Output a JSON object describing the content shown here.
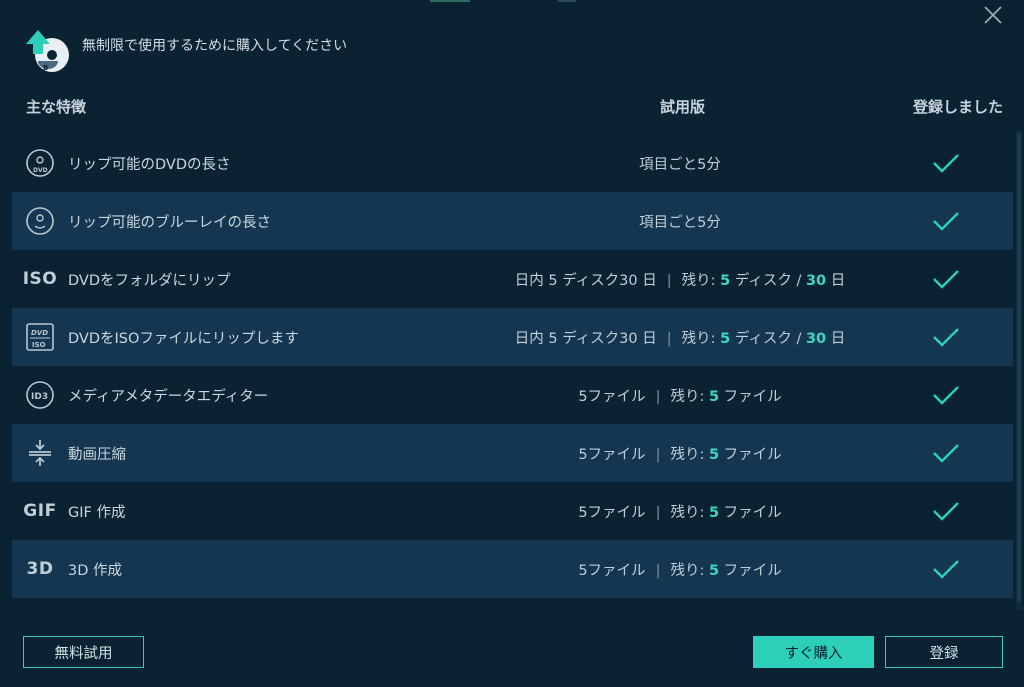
{
  "header": {
    "message": "無制限で使用するために購入してください"
  },
  "columns": {
    "feature": "主な特徴",
    "trial": "試用版",
    "registered": "登録しました"
  },
  "icon_text": {
    "iso": "ISO",
    "gif": "GIF",
    "3d": "3D"
  },
  "rows": [
    {
      "icon": "dvd-disc-icon",
      "label": "リップ可能のDVDの長さ",
      "trial_text": "項目ごと5分"
    },
    {
      "icon": "bluray-disc-icon",
      "label": "リップ可能のブルーレイの長さ",
      "trial_text": "項目ごと5分"
    },
    {
      "icon": "iso-icon",
      "label": "DVDをフォルダにリップ",
      "trial_prefix": "日内 5 ディスク30 日",
      "remain_label": "残り:",
      "remain_num": "5",
      "remain_unit": "ディスク /",
      "remain_num2": "30",
      "remain_unit2": "日"
    },
    {
      "icon": "dvd-iso-icon",
      "label": "DVDをISOファイルにリップします",
      "trial_prefix": "日内 5 ディスク30 日",
      "remain_label": "残り:",
      "remain_num": "5",
      "remain_unit": "ディスク /",
      "remain_num2": "30",
      "remain_unit2": "日"
    },
    {
      "icon": "id3-icon",
      "label": "メディアメタデータエディター",
      "trial_prefix": "5ファイル",
      "remain_label": "残り:",
      "remain_num": "5",
      "remain_unit": "ファイル"
    },
    {
      "icon": "compress-icon",
      "label": "動画圧縮",
      "trial_prefix": "5ファイル",
      "remain_label": "残り:",
      "remain_num": "5",
      "remain_unit": "ファイル"
    },
    {
      "icon": "gif-icon",
      "label": "GIF 作成",
      "trial_prefix": "5ファイル",
      "remain_label": "残り:",
      "remain_num": "5",
      "remain_unit": "ファイル"
    },
    {
      "icon": "3d-icon",
      "label": "3D 作成",
      "trial_prefix": "5ファイル",
      "remain_label": "残り:",
      "remain_num": "5",
      "remain_unit": "ファイル"
    }
  ],
  "separator": "|",
  "buttons": {
    "free_trial": "無料試用",
    "buy_now": "すぐ購入",
    "register": "登録"
  },
  "colors": {
    "background": "#0b2233",
    "row_alt": "#143650",
    "accent": "#2ccfb8",
    "highlight": "#3fd6c2"
  }
}
